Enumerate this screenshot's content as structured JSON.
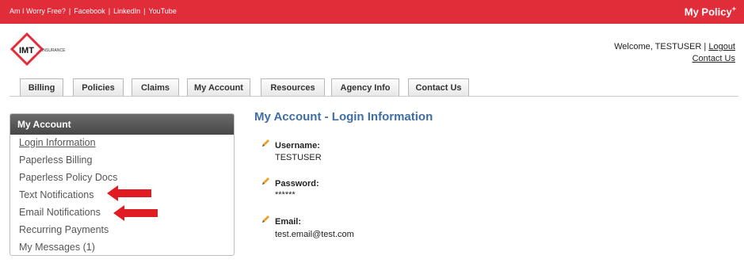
{
  "topbar": {
    "links": [
      "Am I Worry Free?",
      "Facebook",
      "LinkedIn",
      "YouTube"
    ],
    "brand": "My Policy",
    "brand_plus": "+"
  },
  "header": {
    "logo_text": "IMT",
    "logo_subtext": "INSURANCE",
    "welcome_text": "Welcome, TESTUSER |",
    "logout": "Logout",
    "contact": "Contact Us"
  },
  "tabs": [
    "Billing",
    "Policies",
    "Claims",
    "My Account",
    "Resources",
    "Agency Info",
    "Contact Us"
  ],
  "sidebar": {
    "title": "My Account",
    "items": [
      {
        "label": "Login Information"
      },
      {
        "label": "Paperless Billing"
      },
      {
        "label": "Paperless Policy Docs"
      },
      {
        "label": "Text Notifications"
      },
      {
        "label": "Email Notifications"
      },
      {
        "label": "Recurring Payments"
      },
      {
        "label": "My Messages (1)"
      }
    ]
  },
  "main": {
    "title": "My Account - Login Information",
    "fields": [
      {
        "label": "Username:",
        "value": "TESTUSER"
      },
      {
        "label": "Password:",
        "value": "******"
      },
      {
        "label": "Email:",
        "value": "test.email@test.com"
      }
    ]
  },
  "colors": {
    "brand_red": "#e12d39",
    "title_blue": "#3f6ea5",
    "arrow_red": "#e11b22"
  }
}
